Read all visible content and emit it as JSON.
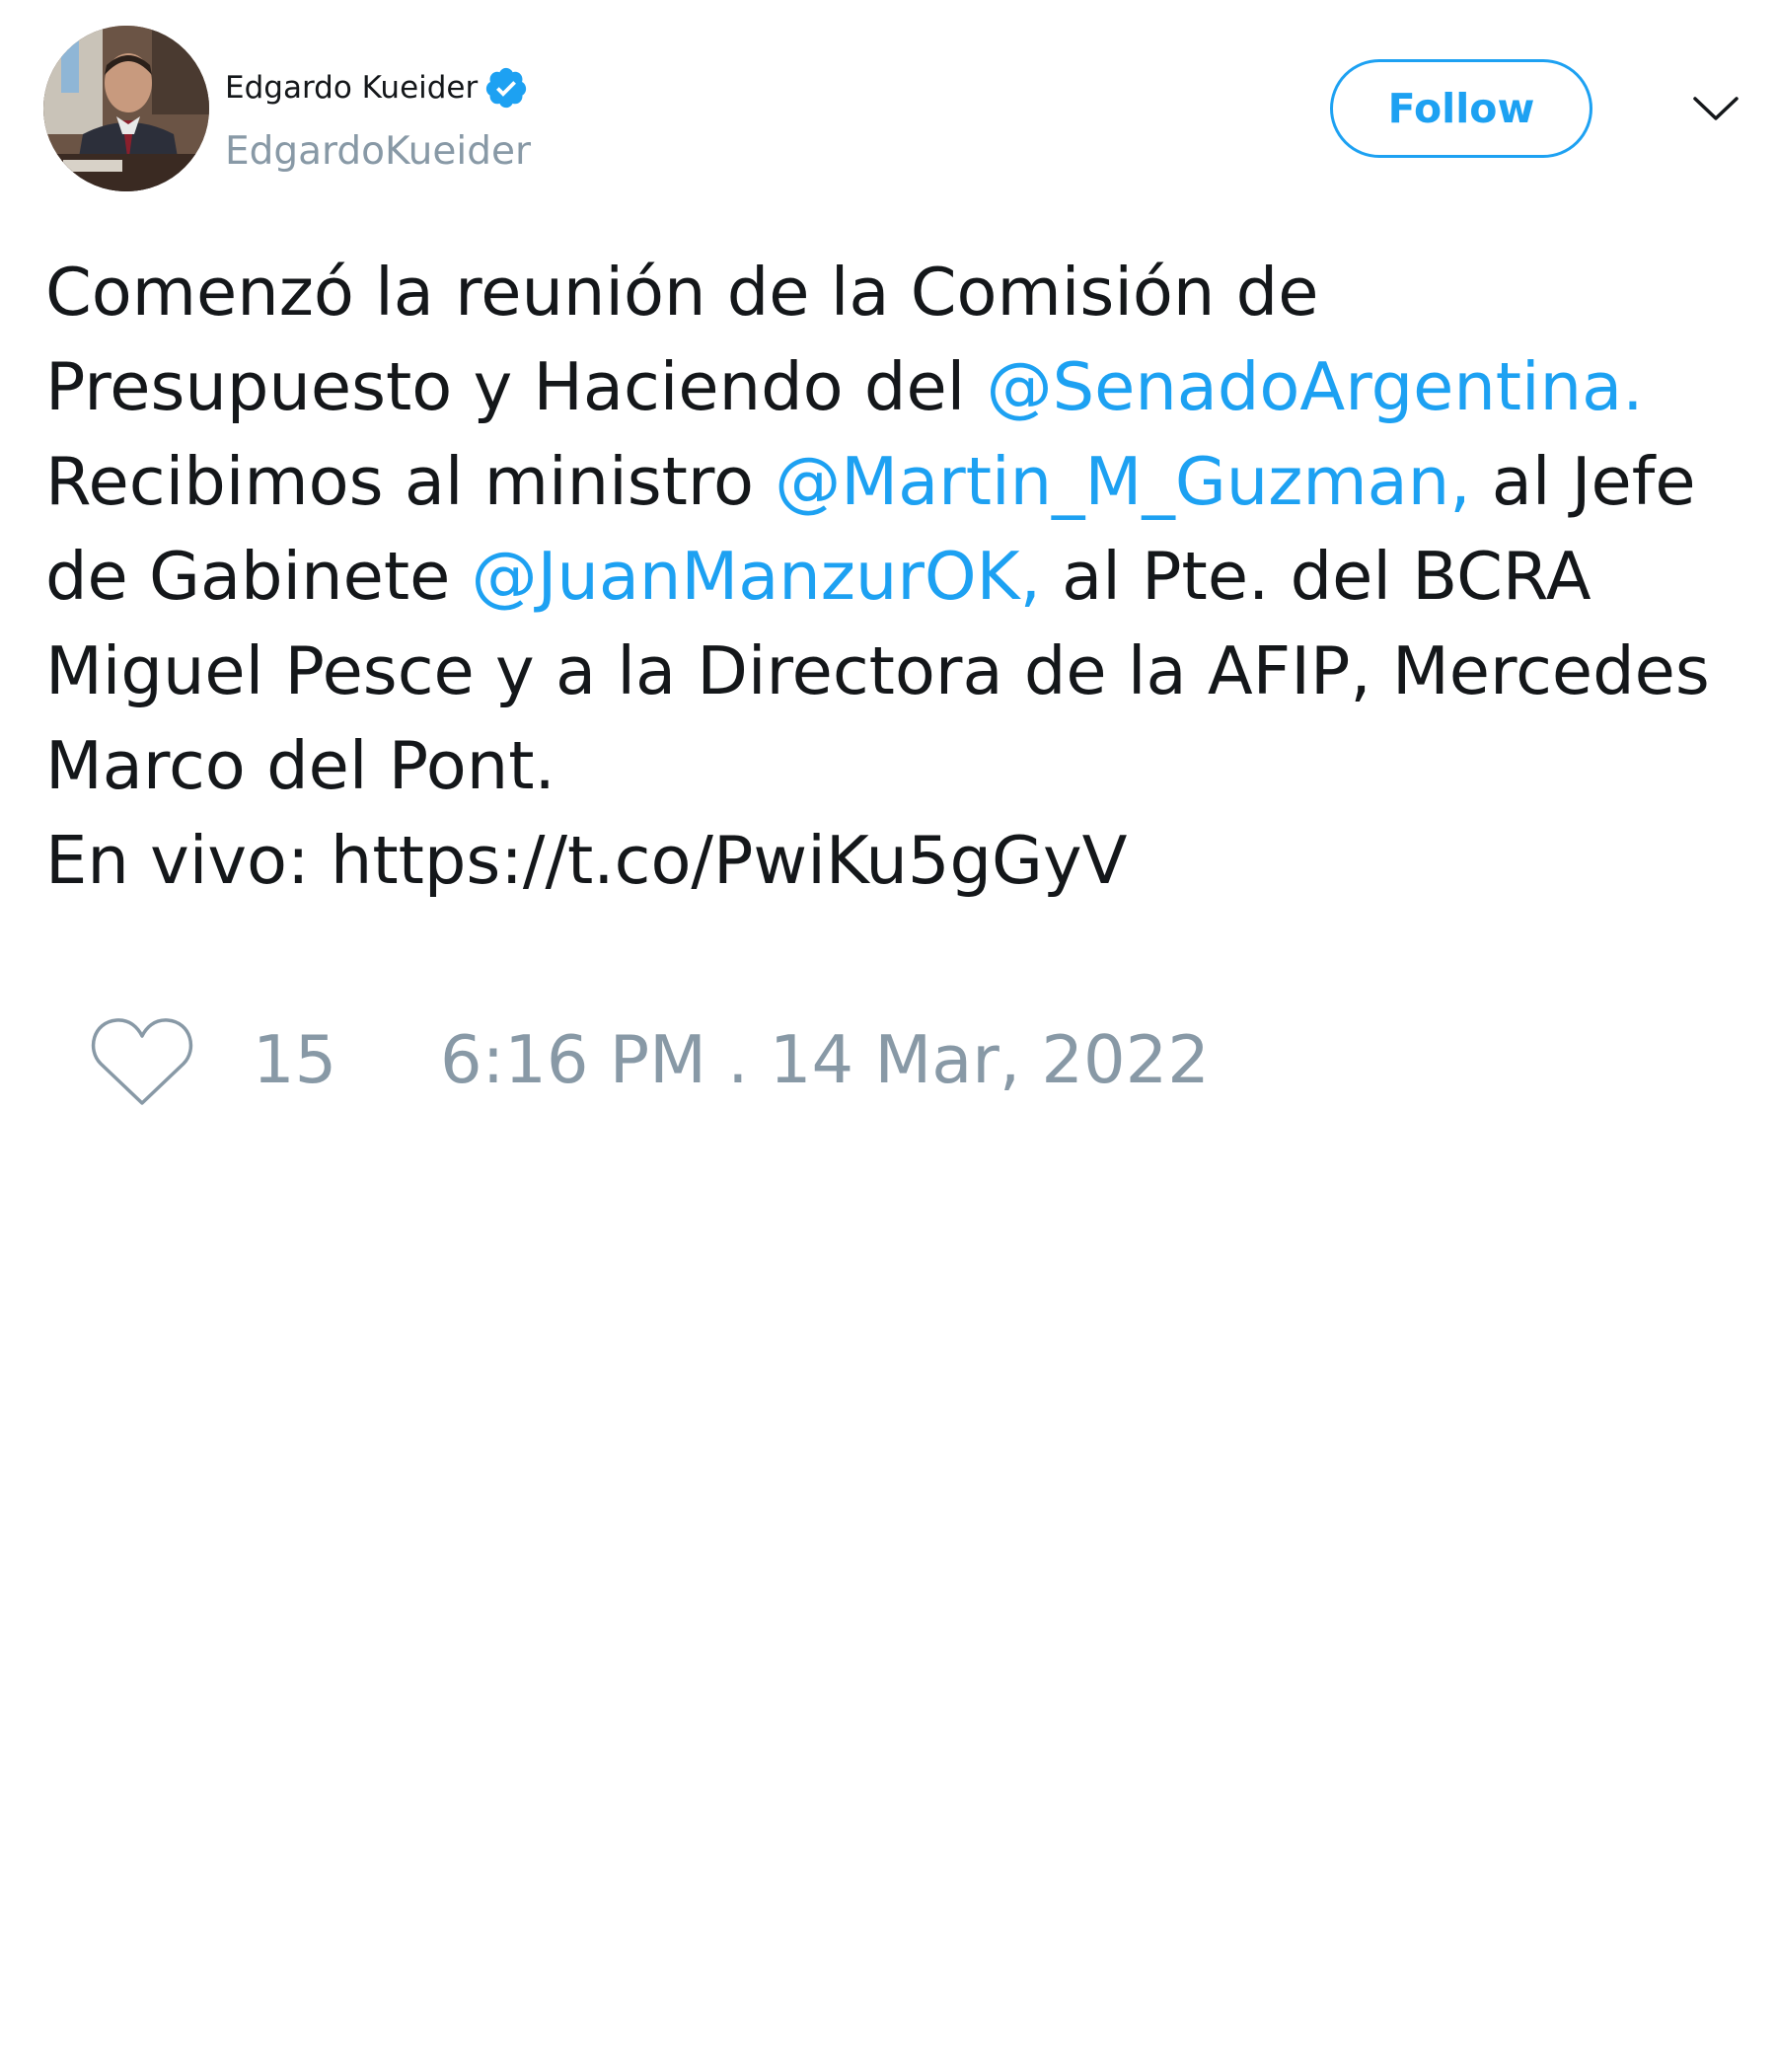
{
  "user": {
    "display_name": "Edgardo Kueider",
    "handle": "EdgardoKueider",
    "verified": true,
    "verified_icon": "verified-badge-icon",
    "avatar": "profile-photo"
  },
  "actions": {
    "follow_label": "Follow",
    "menu_icon": "chevron-down-icon"
  },
  "tweet": {
    "line1": "Comenzó la reunión de la Comisión de",
    "line2_text": "Presupuesto y Haciendo del ",
    "line2_mention": "@SenadoArgentina.",
    "line3_text": "Recibimos al ministro ",
    "line3_mention": "@Martin_M_Guzman,",
    "line3_tail": " al Jefe",
    "line4_text": "de Gabinete ",
    "line4_mention": "@JuanManzurOK,",
    "line4_tail": " al Pte. del BCRA",
    "line5": "Miguel Pesce y a la Directora de la AFIP, Mercedes",
    "line6": "Marco del Pont.",
    "line7_text": "En vivo: ",
    "line7_link": "https://t.co/PwiKu5gGyV"
  },
  "footer": {
    "like_icon": "heart-icon",
    "like_count": "15",
    "timestamp": "6:16 PM . 14 Mar, 2022"
  },
  "colors": {
    "accent": "#1da1f2",
    "text": "#14171a",
    "muted": "#8899a6",
    "background": "#ffffff"
  }
}
